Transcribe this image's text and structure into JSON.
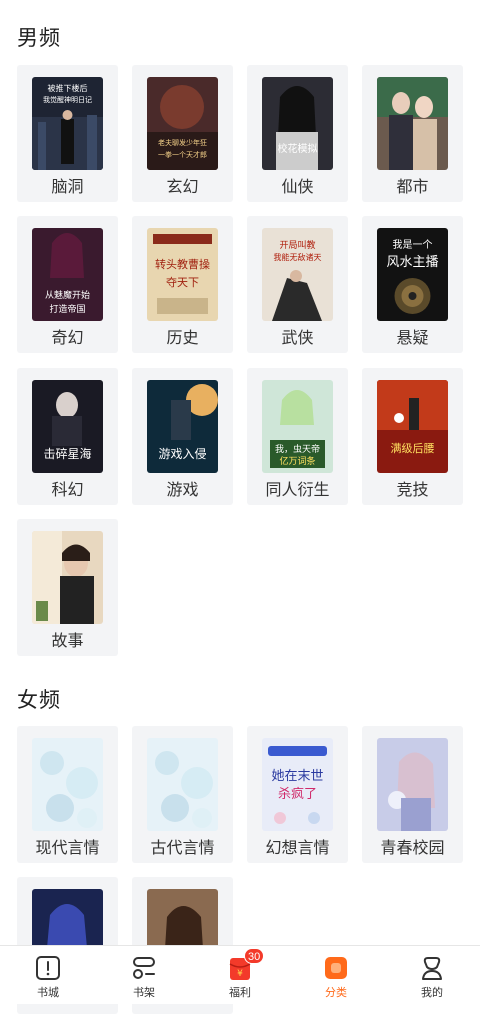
{
  "sections": {
    "male": {
      "title": "男频",
      "categories": [
        {
          "label": "脑洞",
          "cover_title": "被推下楼后，我觉醒了神明日记"
        },
        {
          "label": "玄幻",
          "cover_title": "老夫聊发少年狂，一拳一个天才郎"
        },
        {
          "label": "仙侠",
          "cover_title": "校花模拟：我入主"
        },
        {
          "label": "都市",
          "cover_title": ""
        },
        {
          "label": "奇幻",
          "cover_title": "从魅魔开始打造帝国"
        },
        {
          "label": "历史",
          "cover_title": "转头教曹操夺天下"
        },
        {
          "label": "武侠",
          "cover_title": "开局叫教，我能无敌诸天"
        },
        {
          "label": "悬疑",
          "cover_title": "我是一个风水主播"
        },
        {
          "label": "科幻",
          "cover_title": "击碎星海"
        },
        {
          "label": "游戏",
          "cover_title": "游戏入侵"
        },
        {
          "label": "同人衍生",
          "cover_title": "我，虫天帝亿万词条"
        },
        {
          "label": "竞技",
          "cover_title": "满级后腰"
        },
        {
          "label": "故事",
          "cover_title": ""
        }
      ]
    },
    "female": {
      "title": "女频",
      "categories": [
        {
          "label": "现代言情",
          "cover_title": ""
        },
        {
          "label": "古代言情",
          "cover_title": ""
        },
        {
          "label": "幻想言情",
          "cover_title": "她在末世杀疯了"
        },
        {
          "label": "青春校园",
          "cover_title": ""
        },
        {
          "label": "",
          "cover_title": ""
        },
        {
          "label": "",
          "cover_title": ""
        }
      ]
    }
  },
  "tabbar": {
    "items": [
      {
        "label": "书城",
        "icon": "bookstore-icon"
      },
      {
        "label": "书架",
        "icon": "bookshelf-icon"
      },
      {
        "label": "福利",
        "icon": "red-envelope-icon",
        "badge": "30"
      },
      {
        "label": "分类",
        "icon": "category-icon",
        "active": true
      },
      {
        "label": "我的",
        "icon": "profile-icon"
      }
    ]
  },
  "colors": {
    "accent": "#ff6a1a",
    "badge": "#f33a2a",
    "card_bg": "#f3f4f6"
  }
}
